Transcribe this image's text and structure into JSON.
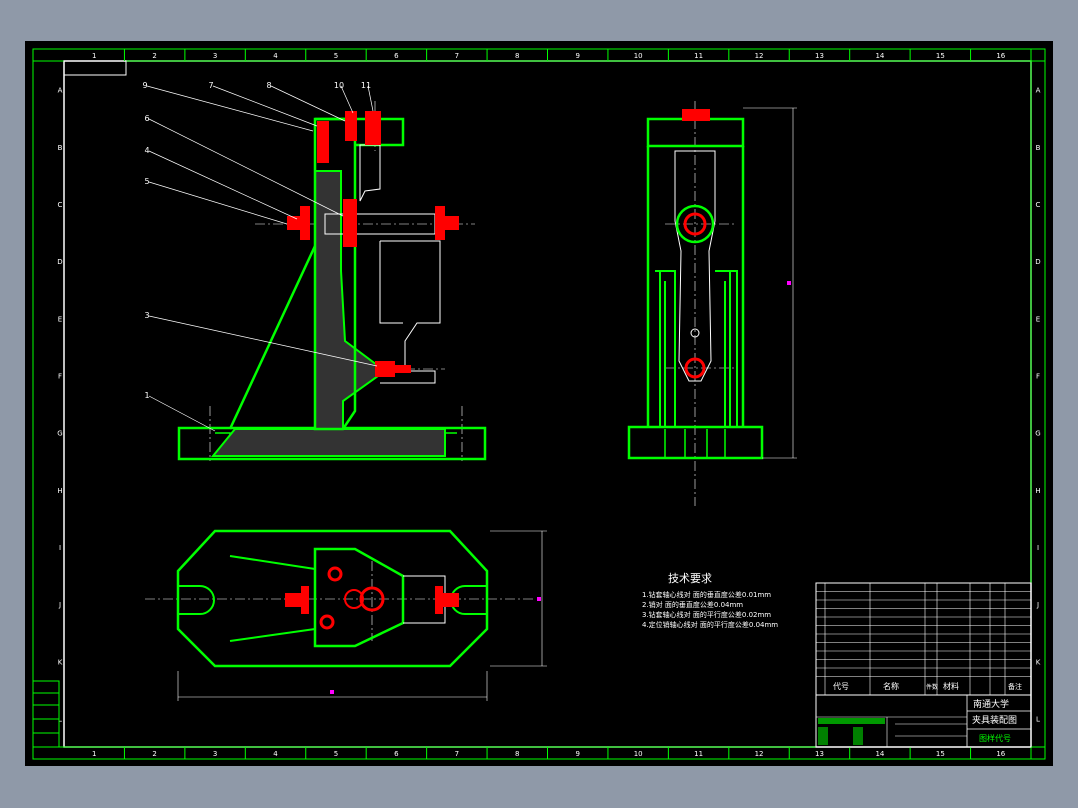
{
  "drawing": {
    "column_numbers": [
      "1",
      "2",
      "3",
      "4",
      "5",
      "6",
      "7",
      "8",
      "9",
      "10",
      "11",
      "12",
      "13",
      "14",
      "15",
      "16"
    ],
    "row_letters": [
      "A",
      "B",
      "C",
      "D",
      "E",
      "F",
      "G",
      "H",
      "I",
      "J",
      "K",
      "L"
    ],
    "leader_labels": [
      "9",
      "7",
      "8",
      "10",
      "11",
      "6",
      "4",
      "5",
      "3",
      "1"
    ],
    "requirements_title": "技术要求",
    "requirements": [
      "1.钻套轴心线对  面的垂直度公差0.01mm",
      "2.销对  面的垂直度公差0.04mm",
      "3.钻套轴心线对  面的平行度公差0.02mm",
      "4.定位销轴心线对  面的平行度公差0.04mm"
    ],
    "title_block": {
      "header_code": "代号",
      "header_name": "名称",
      "header_qty": "件数",
      "header_material": "材料",
      "header_note": "备注",
      "school": "南通大学",
      "drawing_title": "夹具装配图",
      "drawing_no": "图样代号"
    }
  },
  "colors": {
    "outline": "#00ff00",
    "parts": "#ff0000",
    "lines": "#ffffff",
    "dimension": "#ff00ff"
  }
}
